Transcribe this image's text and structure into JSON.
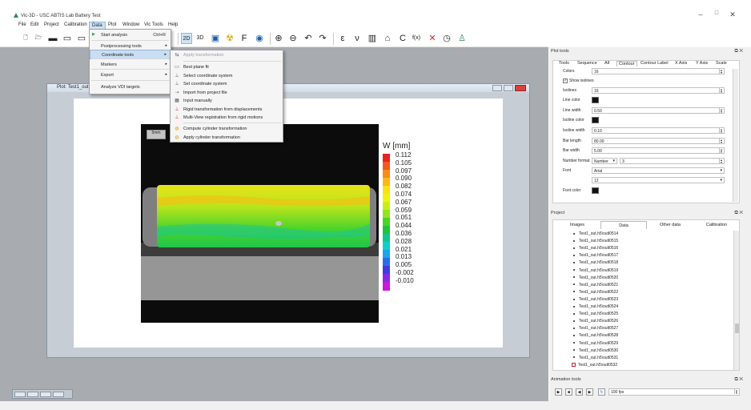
{
  "window": {
    "title": "Vic-3D - USC ABTIS Lab Battery Test",
    "icon_color": "#2e8b57"
  },
  "menubar": {
    "items": [
      "File",
      "Edit",
      "Project",
      "Calibration",
      "Data",
      "Plot",
      "Window",
      "Vic Tools",
      "Help"
    ],
    "active": "Data"
  },
  "data_menu": {
    "items": [
      {
        "label": "Start analysis",
        "shortcut": "Ctrl+R",
        "submenu": false,
        "highlighted": false
      },
      {
        "label": "Postprocessing tools",
        "shortcut": "",
        "submenu": true,
        "highlighted": false
      },
      {
        "label": "Coordinate tools",
        "shortcut": "",
        "submenu": true,
        "highlighted": true
      },
      {
        "label": "Markers",
        "shortcut": "",
        "submenu": true,
        "highlighted": false
      },
      {
        "label": "Export",
        "shortcut": "",
        "submenu": true,
        "highlighted": false
      },
      {
        "label": "Analyze VDI targets",
        "shortcut": "",
        "submenu": false,
        "highlighted": false
      }
    ]
  },
  "coord_menu": {
    "items": [
      {
        "label": "Apply transformation",
        "disabled": true,
        "icon": "transform-icon",
        "glyph": "⇆"
      },
      {
        "label": "Best plane fit",
        "disabled": false,
        "icon": "plane-fit-icon",
        "glyph": "▭"
      },
      {
        "label": "Select coordinate system",
        "disabled": false,
        "icon": "axes-icon",
        "glyph": "⊥"
      },
      {
        "label": "Set coordinate system",
        "disabled": false,
        "icon": "axes-icon",
        "glyph": "⊥"
      },
      {
        "label": "Import from project file",
        "disabled": false,
        "icon": "import-icon",
        "glyph": "⇢"
      },
      {
        "label": "Input manually",
        "disabled": false,
        "icon": "keyboard-icon",
        "glyph": "▦"
      },
      {
        "label": "Rigid transformation from displacements",
        "disabled": false,
        "icon": "rigid-icon",
        "glyph": "⊥"
      },
      {
        "label": "Multi-View registration from rigid motions",
        "disabled": false,
        "icon": "multiview-icon",
        "glyph": "⊥"
      },
      {
        "label": "Compute cylinder transformation",
        "disabled": false,
        "icon": "cylinder-icon",
        "glyph": "◍"
      },
      {
        "label": "Apply cylinder transformation",
        "disabled": false,
        "icon": "cylinder-icon",
        "glyph": "◍"
      }
    ]
  },
  "toolbar": {
    "buttons": [
      {
        "name": "new-file-icon",
        "glyph": "🗋"
      },
      {
        "name": "open-folder-icon",
        "glyph": "🗁"
      },
      {
        "name": "save-icon",
        "glyph": "▬"
      },
      {
        "name": "folder-icon",
        "glyph": "▭"
      },
      {
        "name": "folder2-icon",
        "glyph": "▭"
      },
      {
        "name": "2d-view-icon",
        "glyph": "2D"
      },
      {
        "name": "3d-view-icon",
        "glyph": "3D"
      },
      {
        "name": "monitor-icon",
        "glyph": "▣"
      },
      {
        "name": "radiation-icon",
        "glyph": "☢"
      },
      {
        "name": "function-f-icon",
        "glyph": "F"
      },
      {
        "name": "eye-icon",
        "glyph": "◉"
      },
      {
        "name": "zoom-in-icon",
        "glyph": "⊕"
      },
      {
        "name": "zoom-out-icon",
        "glyph": "⊖"
      },
      {
        "name": "undo-icon",
        "glyph": "↶"
      },
      {
        "name": "redo-icon",
        "glyph": "↷"
      },
      {
        "name": "epsilon-icon",
        "glyph": "ε"
      },
      {
        "name": "nu-icon",
        "glyph": "ν"
      },
      {
        "name": "histogram-icon",
        "glyph": "▥"
      },
      {
        "name": "extensometer-icon",
        "glyph": "⌂"
      },
      {
        "name": "c-icon",
        "glyph": "C"
      },
      {
        "name": "fx-icon",
        "glyph": "f(x)"
      },
      {
        "name": "red-x-icon",
        "glyph": "✕"
      },
      {
        "name": "clock-icon",
        "glyph": "◷"
      },
      {
        "name": "person-icon",
        "glyph": "♙"
      }
    ]
  },
  "plot_window": {
    "title": "Plot: Test1_out..",
    "controls": [
      "minimize",
      "maximize",
      "close"
    ]
  },
  "plot": {
    "scale_label": "5mm",
    "colorbar_title": "W [mm]",
    "ticks": [
      "0.112",
      "0.105",
      "0.097",
      "0.090",
      "0.082",
      "0.074",
      "0.067",
      "0.059",
      "0.051",
      "0.044",
      "0.036",
      "0.028",
      "0.021",
      "0.013",
      "0.005",
      "-0.002",
      "-0.010"
    ],
    "colors": [
      "#e8221f",
      "#f05a1d",
      "#f68a1b",
      "#fbb919",
      "#fde016",
      "#eef017",
      "#c7ee1a",
      "#93e31f",
      "#4bd325",
      "#1ec43d",
      "#15c58b",
      "#12cfcc",
      "#1ba6e6",
      "#2a6de9",
      "#3f3ae6",
      "#8a2ae0",
      "#c71bd7"
    ]
  },
  "plot_tools": {
    "header": "Plot tools",
    "tabs": [
      "Tools",
      "Sequence",
      "All",
      "Contour",
      "Contour Label",
      "X Axis",
      "Y Axis",
      "Scale"
    ],
    "active_tab": "Contour",
    "rows": [
      {
        "label": "Colors",
        "value": "16",
        "type": "spin"
      },
      {
        "label": "Show isolines",
        "value": "",
        "type": "checkbox"
      },
      {
        "label": "Isolines",
        "value": "16",
        "type": "spin"
      },
      {
        "label": "Line color",
        "value": "",
        "type": "color"
      },
      {
        "label": "Line width",
        "value": "0.50",
        "type": "spin"
      },
      {
        "label": "Isoline color",
        "value": "",
        "type": "color"
      },
      {
        "label": "Isoline width",
        "value": "0.10",
        "type": "spin"
      },
      {
        "label": "Bar length",
        "value": "80.00",
        "type": "spin"
      },
      {
        "label": "Bar width",
        "value": "5.00",
        "type": "spin"
      },
      {
        "label": "Number format",
        "value": "Number",
        "type": "format",
        "precision": "3"
      },
      {
        "label": "Font",
        "value": "Arial",
        "type": "select"
      },
      {
        "label": "",
        "value": "12",
        "type": "select"
      },
      {
        "label": "Font color",
        "value": "",
        "type": "color"
      }
    ]
  },
  "project": {
    "header": "Project",
    "tabs": [
      "Images",
      "Data",
      "Other data",
      "Calibration"
    ],
    "active_tab": "Data",
    "files": [
      "Test1_out.h5\\outl0514",
      "Test1_out.h5\\outl0515",
      "Test1_out.h5\\outl0516",
      "Test1_out.h5\\outl0517",
      "Test1_out.h5\\outl0518",
      "Test1_out.h5\\outl0519",
      "Test1_out.h5\\outl0520",
      "Test1_out.h5\\outl0521",
      "Test1_out.h5\\outl0522",
      "Test1_out.h5\\outl0523",
      "Test1_out.h5\\outl0524",
      "Test1_out.h5\\outl0525",
      "Test1_out.h5\\outl0526",
      "Test1_out.h5\\outl0527",
      "Test1_out.h5\\outl0528",
      "Test1_out.h5\\outl0529",
      "Test1_out.h5\\outl0530",
      "Test1_out.h5\\outl0531",
      "Test1_out.h5\\outl0532"
    ]
  },
  "animation": {
    "header": "Animation tools",
    "fps": "100 fps"
  }
}
